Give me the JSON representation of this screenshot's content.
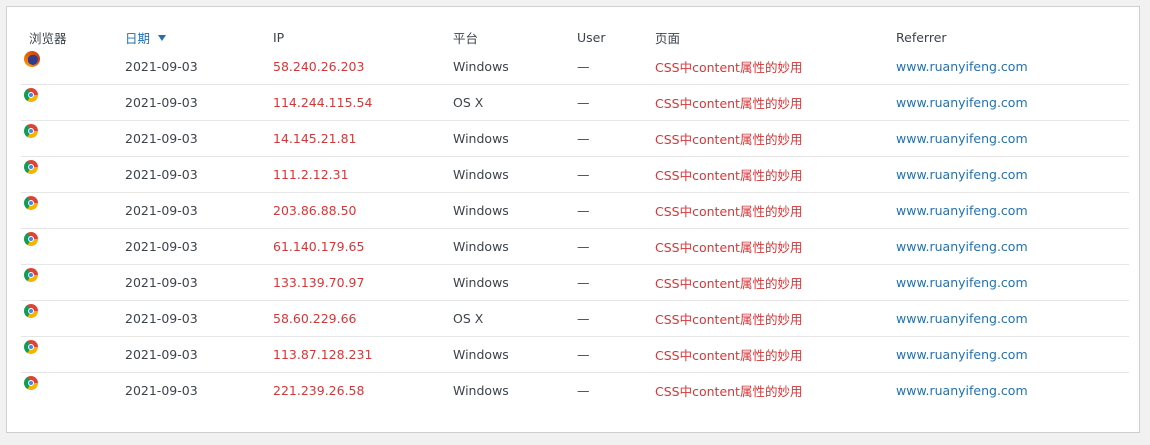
{
  "headers": {
    "browser": "浏览器",
    "date": "日期",
    "ip": "IP",
    "platform": "平台",
    "user": "User",
    "page": "页面",
    "referrer": "Referrer"
  },
  "rows": [
    {
      "browser_icon": "firefox-icon",
      "date": "2021-09-03",
      "ip": "58.240.26.203",
      "platform": "Windows",
      "user": "—",
      "page": "CSS中content属性的妙用",
      "referrer": "www.ruanyifeng.com"
    },
    {
      "browser_icon": "chrome-icon",
      "date": "2021-09-03",
      "ip": "114.244.115.54",
      "platform": "OS X",
      "user": "—",
      "page": "CSS中content属性的妙用",
      "referrer": "www.ruanyifeng.com"
    },
    {
      "browser_icon": "chrome-icon",
      "date": "2021-09-03",
      "ip": "14.145.21.81",
      "platform": "Windows",
      "user": "—",
      "page": "CSS中content属性的妙用",
      "referrer": "www.ruanyifeng.com"
    },
    {
      "browser_icon": "chrome-icon",
      "date": "2021-09-03",
      "ip": "111.2.12.31",
      "platform": "Windows",
      "user": "—",
      "page": "CSS中content属性的妙用",
      "referrer": "www.ruanyifeng.com"
    },
    {
      "browser_icon": "chrome-icon",
      "date": "2021-09-03",
      "ip": "203.86.88.50",
      "platform": "Windows",
      "user": "—",
      "page": "CSS中content属性的妙用",
      "referrer": "www.ruanyifeng.com"
    },
    {
      "browser_icon": "chrome-icon",
      "date": "2021-09-03",
      "ip": "61.140.179.65",
      "platform": "Windows",
      "user": "—",
      "page": "CSS中content属性的妙用",
      "referrer": "www.ruanyifeng.com"
    },
    {
      "browser_icon": "chrome-icon",
      "date": "2021-09-03",
      "ip": "133.139.70.97",
      "platform": "Windows",
      "user": "—",
      "page": "CSS中content属性的妙用",
      "referrer": "www.ruanyifeng.com"
    },
    {
      "browser_icon": "chrome-icon",
      "date": "2021-09-03",
      "ip": "58.60.229.66",
      "platform": "OS X",
      "user": "—",
      "page": "CSS中content属性的妙用",
      "referrer": "www.ruanyifeng.com"
    },
    {
      "browser_icon": "chrome-icon",
      "date": "2021-09-03",
      "ip": "113.87.128.231",
      "platform": "Windows",
      "user": "—",
      "page": "CSS中content属性的妙用",
      "referrer": "www.ruanyifeng.com"
    },
    {
      "browser_icon": "chrome-icon",
      "date": "2021-09-03",
      "ip": "221.239.26.58",
      "platform": "Windows",
      "user": "—",
      "page": "CSS中content属性的妙用",
      "referrer": "www.ruanyifeng.com"
    }
  ],
  "colors": {
    "ip": "#d63638",
    "page": "#d63638",
    "referrer": "#2271b1",
    "sorted_header": "#2271b1"
  }
}
